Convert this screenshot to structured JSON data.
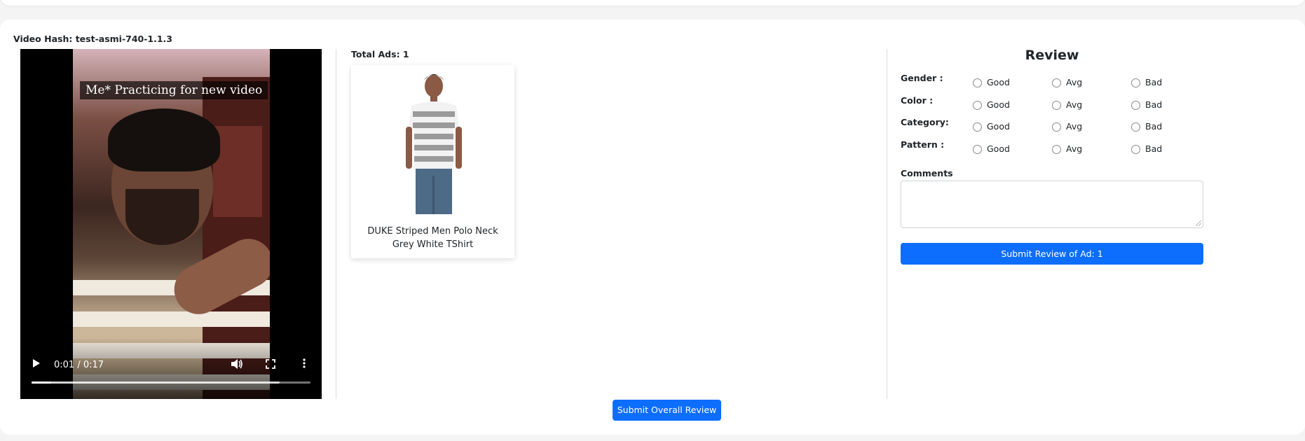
{
  "video": {
    "hash_label": "Video Hash:",
    "hash_value": "test-asmi-740-1.1.3",
    "overlay_caption": "Me* Practicing for new video",
    "time_display": "0:01 / 0:17",
    "progress_fraction": 0.07,
    "buffered_fraction": 0.89,
    "controls": {
      "play_icon": "play-icon",
      "volume_icon": "volume-icon",
      "fullscreen_icon": "fullscreen-icon",
      "more_icon": "more-options-icon"
    }
  },
  "ads": {
    "total_label": "Total Ads: 1",
    "items": [
      {
        "title": "DUKE Striped Men Polo Neck Grey White TShirt"
      }
    ]
  },
  "review": {
    "title": "Review",
    "rows": [
      {
        "label": "Gender :",
        "options": [
          "Good",
          "Avg",
          "Bad"
        ]
      },
      {
        "label": "Color :",
        "options": [
          "Good",
          "Avg",
          "Bad"
        ]
      },
      {
        "label": "Category:",
        "options": [
          "Good",
          "Avg",
          "Bad"
        ]
      },
      {
        "label": "Pattern :",
        "options": [
          "Good",
          "Avg",
          "Bad"
        ]
      }
    ],
    "comments_label": "Comments",
    "comments_value": "",
    "submit_label": "Submit Review of Ad: 1"
  },
  "footer": {
    "submit_overall_label": "Submit Overall Review"
  },
  "colors": {
    "primary": "#0d6efd",
    "page_bg": "#f4f4f5",
    "card_bg": "#ffffff"
  }
}
